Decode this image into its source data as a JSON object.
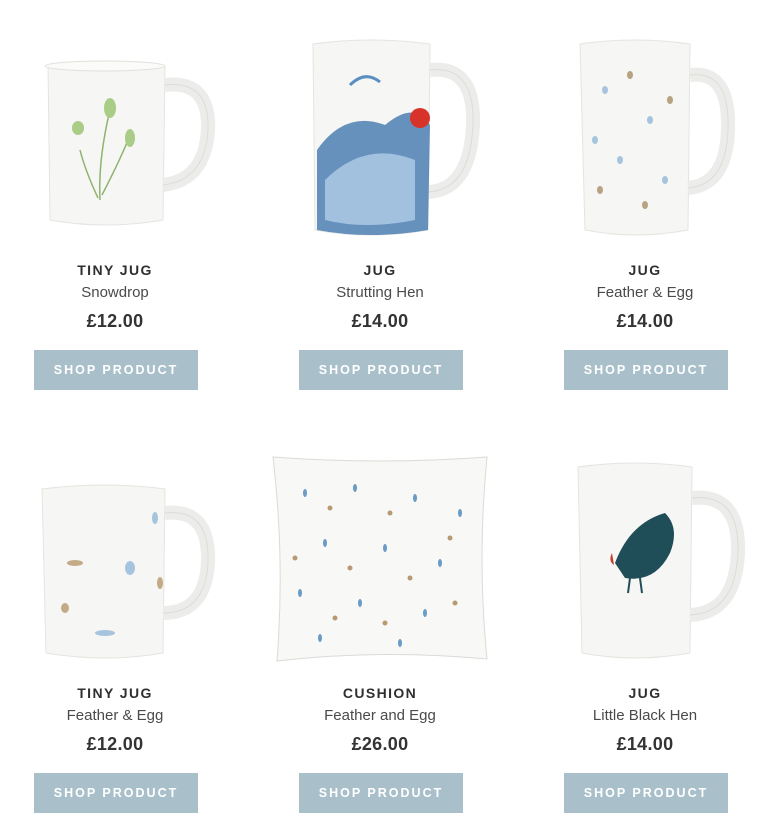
{
  "products": [
    {
      "category": "TINY JUG",
      "name": "Snowdrop",
      "price": "£12.00",
      "button": "SHOP PRODUCT"
    },
    {
      "category": "JUG",
      "name": "Strutting Hen",
      "price": "£14.00",
      "button": "SHOP PRODUCT"
    },
    {
      "category": "JUG",
      "name": "Feather & Egg",
      "price": "£14.00",
      "button": "SHOP PRODUCT"
    },
    {
      "category": "TINY JUG",
      "name": "Feather & Egg",
      "price": "£12.00",
      "button": "SHOP PRODUCT"
    },
    {
      "category": "CUSHION",
      "name": "Feather and Egg",
      "price": "£26.00",
      "button": "SHOP PRODUCT"
    },
    {
      "category": "JUG",
      "name": "Little Black Hen",
      "price": "£14.00",
      "button": "SHOP PRODUCT"
    }
  ],
  "colors": {
    "button_bg": "#a9c0cb",
    "button_text": "#ffffff"
  }
}
